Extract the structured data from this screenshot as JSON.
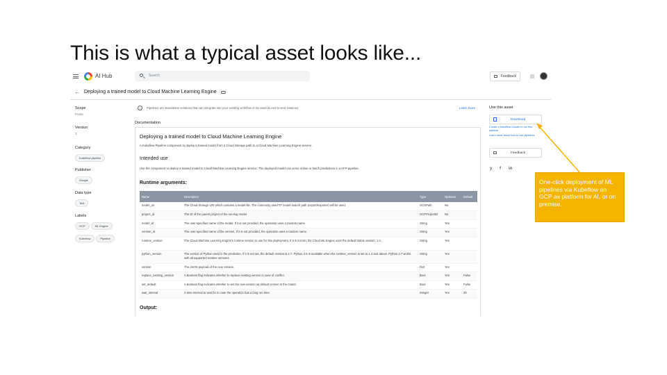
{
  "slide": {
    "title": "This is what a typical asset looks like..."
  },
  "topbar": {
    "app_name": "AI Hub",
    "search_placeholder": "Search",
    "feedback_label": "Feedback"
  },
  "breadcrumb": {
    "title": "Deploying a trained model to Cloud Machine Learning Engine"
  },
  "meta": {
    "scope_label": "Scope",
    "scope_value": "Public",
    "version_label": "Version",
    "version_value": "1",
    "category_label": "Category",
    "category_chip": "Kubeflow pipeline",
    "publisher_label": "Publisher",
    "publisher_chip": "Google",
    "datatype_label": "Data type",
    "datatype_chip": "Text",
    "labels_label": "Labels",
    "labels": [
      "GCP",
      "ML Engine",
      "Kubeflow",
      "Pipeline"
    ]
  },
  "banner": {
    "text": "Pipelines are standalone solutions that can integrate into your existing workflow or be used as end-to-end solutions",
    "learn_more": "Learn more"
  },
  "doc": {
    "section_label": "Documentation",
    "heading": "Deploying a trained model to Cloud Machine Learning Engine",
    "summary": "A Kubeflow Pipeline component to deploy a trained model from a Cloud Storage path to a Cloud Machine Learning Engine service.",
    "intended_use_heading": "Intended use",
    "intended_use_text": "Use the component to deploy a trained model to Cloud Machine Learning Engine service. The deployed model can serve online or batch predictions in a KFP pipeline.",
    "runtime_heading": "Runtime arguments:",
    "output_heading": "Output:",
    "columns": [
      "Name",
      "Description",
      "Type",
      "Optional",
      "Default"
    ],
    "rows": [
      [
        "model_uri",
        "The Cloud Storage URI which contains a model file. The commonly used TF model search path (export/exporter) will be used.",
        "GCSPath",
        "No",
        ""
      ],
      [
        "project_id",
        "The ID of the parent project of the serving model.",
        "GCPProjectID",
        "No",
        ""
      ],
      [
        "model_id",
        "The user-specified name of the model. If it is not provided, the operation uses a random name.",
        "String",
        "Yes",
        ""
      ],
      [
        "version_id",
        "The user-specified name of the version. If it is not provided, the operation uses a random name.",
        "String",
        "Yes",
        ""
      ],
      [
        "runtime_version",
        "The Cloud Machine Learning Engine's runtime version to use for this deployment. If it is not set, the Cloud ML Engine uses the default stable version, 1.0.",
        "String",
        "Yes",
        ""
      ],
      [
        "python_version",
        "The version of Python used in the prediction. If it is not set, the default version is 2.7. Python 3.5 is available when the runtime_version is set to 1.4 and above. Python 2.7 works with all supported runtime versions.",
        "String",
        "Yes",
        ""
      ],
      [
        "version",
        "The JSON payload of the new Version.",
        "Dict",
        "Yes",
        ""
      ],
      [
        "replace_existing_version",
        "A Boolean flag indicates whether to replace existing version in case of conflict.",
        "Bool",
        "Yes",
        "False"
      ],
      [
        "set_default",
        "A Boolean flag indicates whether to set the new version as default version in the model.",
        "Bool",
        "Yes",
        "False"
      ],
      [
        "wait_interval",
        "A time-interval to wait for in case the operation has a long run time.",
        "Integer",
        "Yes",
        "30"
      ]
    ]
  },
  "panel": {
    "use_title": "Use this asset",
    "download_label": "Download",
    "kubeflow_text": "Create a Kubeflow Cluster to run this pipeline",
    "learn_text": "Learn more about how to use pipelines",
    "feedback_label": "Feedback",
    "social": [
      "y",
      "f",
      "in"
    ]
  },
  "callout": {
    "text": "One-click deployment of ML pipelines via Kubeflow on GCP as platform for AI, or on premise.",
    "color": "#f4b400"
  }
}
